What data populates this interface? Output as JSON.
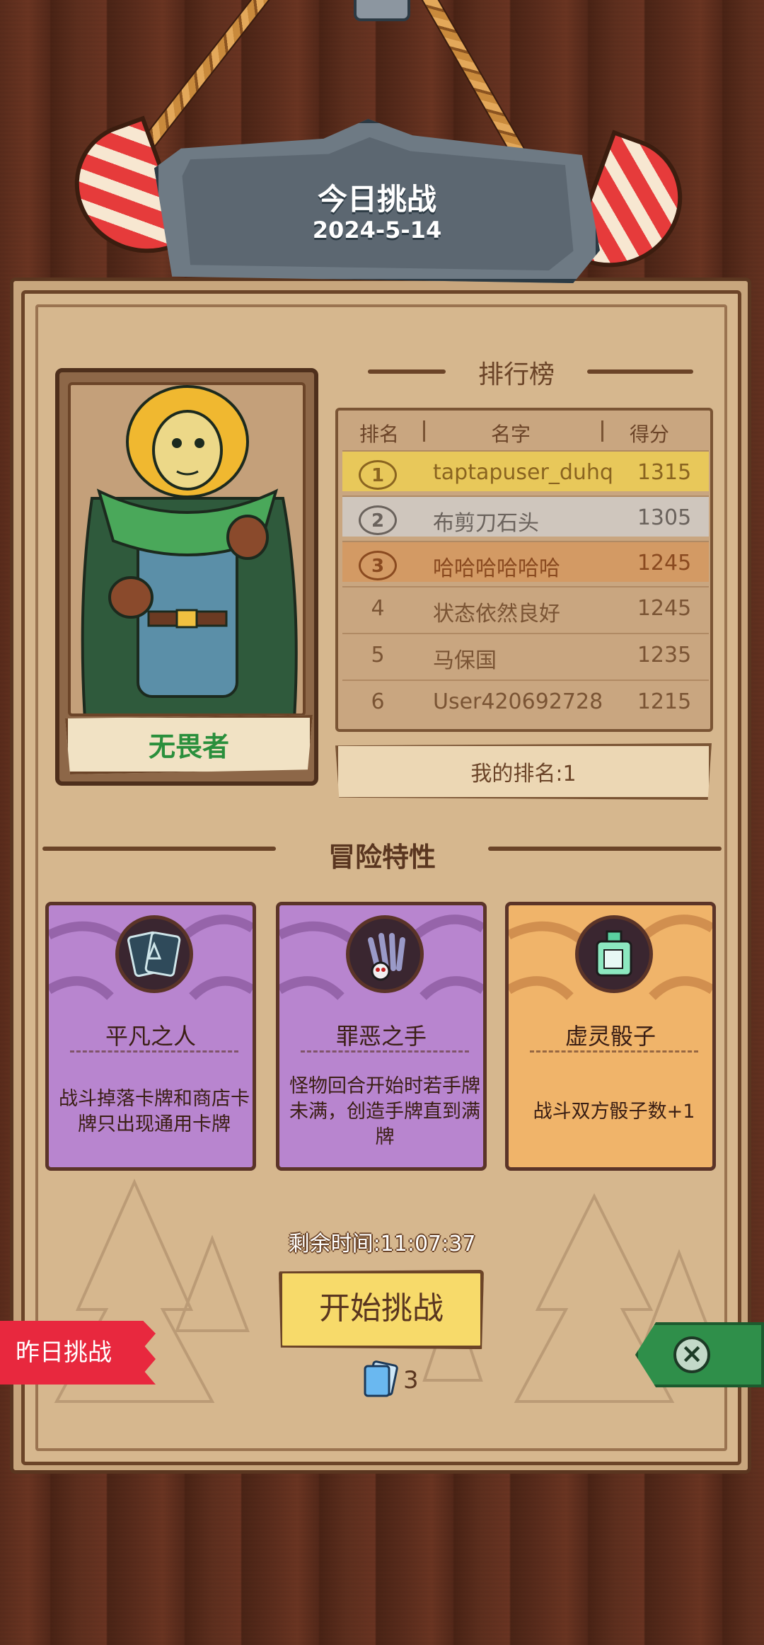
{
  "header": {
    "title": "今日挑战",
    "date": "2024-5-14"
  },
  "hero": {
    "name": "无畏者"
  },
  "leaderboard": {
    "title": "排行榜",
    "columns": [
      "排名",
      "名字",
      "得分"
    ],
    "rows": [
      {
        "rank": "1",
        "name": "taptapuser_duhq",
        "score": "1315",
        "medal": "gold"
      },
      {
        "rank": "2",
        "name": "布剪刀石头",
        "score": "1305",
        "medal": "silver"
      },
      {
        "rank": "3",
        "name": "哈哈哈哈哈哈",
        "score": "1245",
        "medal": "bronze"
      },
      {
        "rank": "4",
        "name": "状态依然良好",
        "score": "1245"
      },
      {
        "rank": "5",
        "name": "马保国",
        "score": "1235"
      },
      {
        "rank": "6",
        "name": "User420692728",
        "score": "1215"
      }
    ],
    "my_rank": "我的排名:1"
  },
  "traits": {
    "title": "冒险特性",
    "items": [
      {
        "name": "平凡之人",
        "desc": "战斗掉落卡牌和商店卡牌只出现通用卡牌",
        "icon": "cards-icon",
        "color": "purple"
      },
      {
        "name": "罪恶之手",
        "desc": "怪物回合开始时若手牌未满，创造手牌直到满牌",
        "icon": "claw-hand-icon",
        "color": "purple"
      },
      {
        "name": "虚灵骰子",
        "desc": "战斗双方骰子数+1",
        "icon": "ghost-dice-icon",
        "color": "orange"
      }
    ]
  },
  "footer": {
    "remaining": "剩余时间:11:07:37",
    "start_button": "开始挑战",
    "ticket_count": "3",
    "yesterday_button": "昨日挑战"
  },
  "colors": {
    "gold_row": "#e8c85a",
    "silver_row": "#cfc6bd",
    "bronze_row": "#d39a64",
    "start_button": "#f7da6a",
    "yesterday_button": "#e8283e",
    "close_tab": "#2f8f4a"
  }
}
